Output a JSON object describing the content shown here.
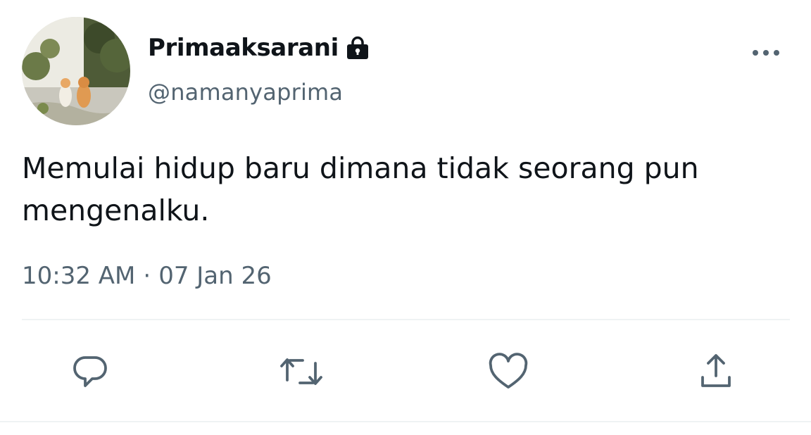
{
  "tweet": {
    "display_name": "Primaaksarani",
    "handle": "@namanyaprima",
    "text": "Memulai hidup baru dimana tidak seorang pun mengenalku.",
    "time": "10:32 AM",
    "separator": "·",
    "date": "07 Jan 26",
    "protected_icon": "lock-icon",
    "avatar_description": "avatar"
  },
  "actions": [
    {
      "name": "reply",
      "icon": "reply-icon"
    },
    {
      "name": "retweet",
      "icon": "retweet-icon"
    },
    {
      "name": "like",
      "icon": "heart-icon"
    },
    {
      "name": "share",
      "icon": "share-icon"
    }
  ],
  "colors": {
    "primary_text": "#0f1419",
    "secondary_text": "#536471",
    "divider": "#eff3f4",
    "icon": "#536471"
  }
}
